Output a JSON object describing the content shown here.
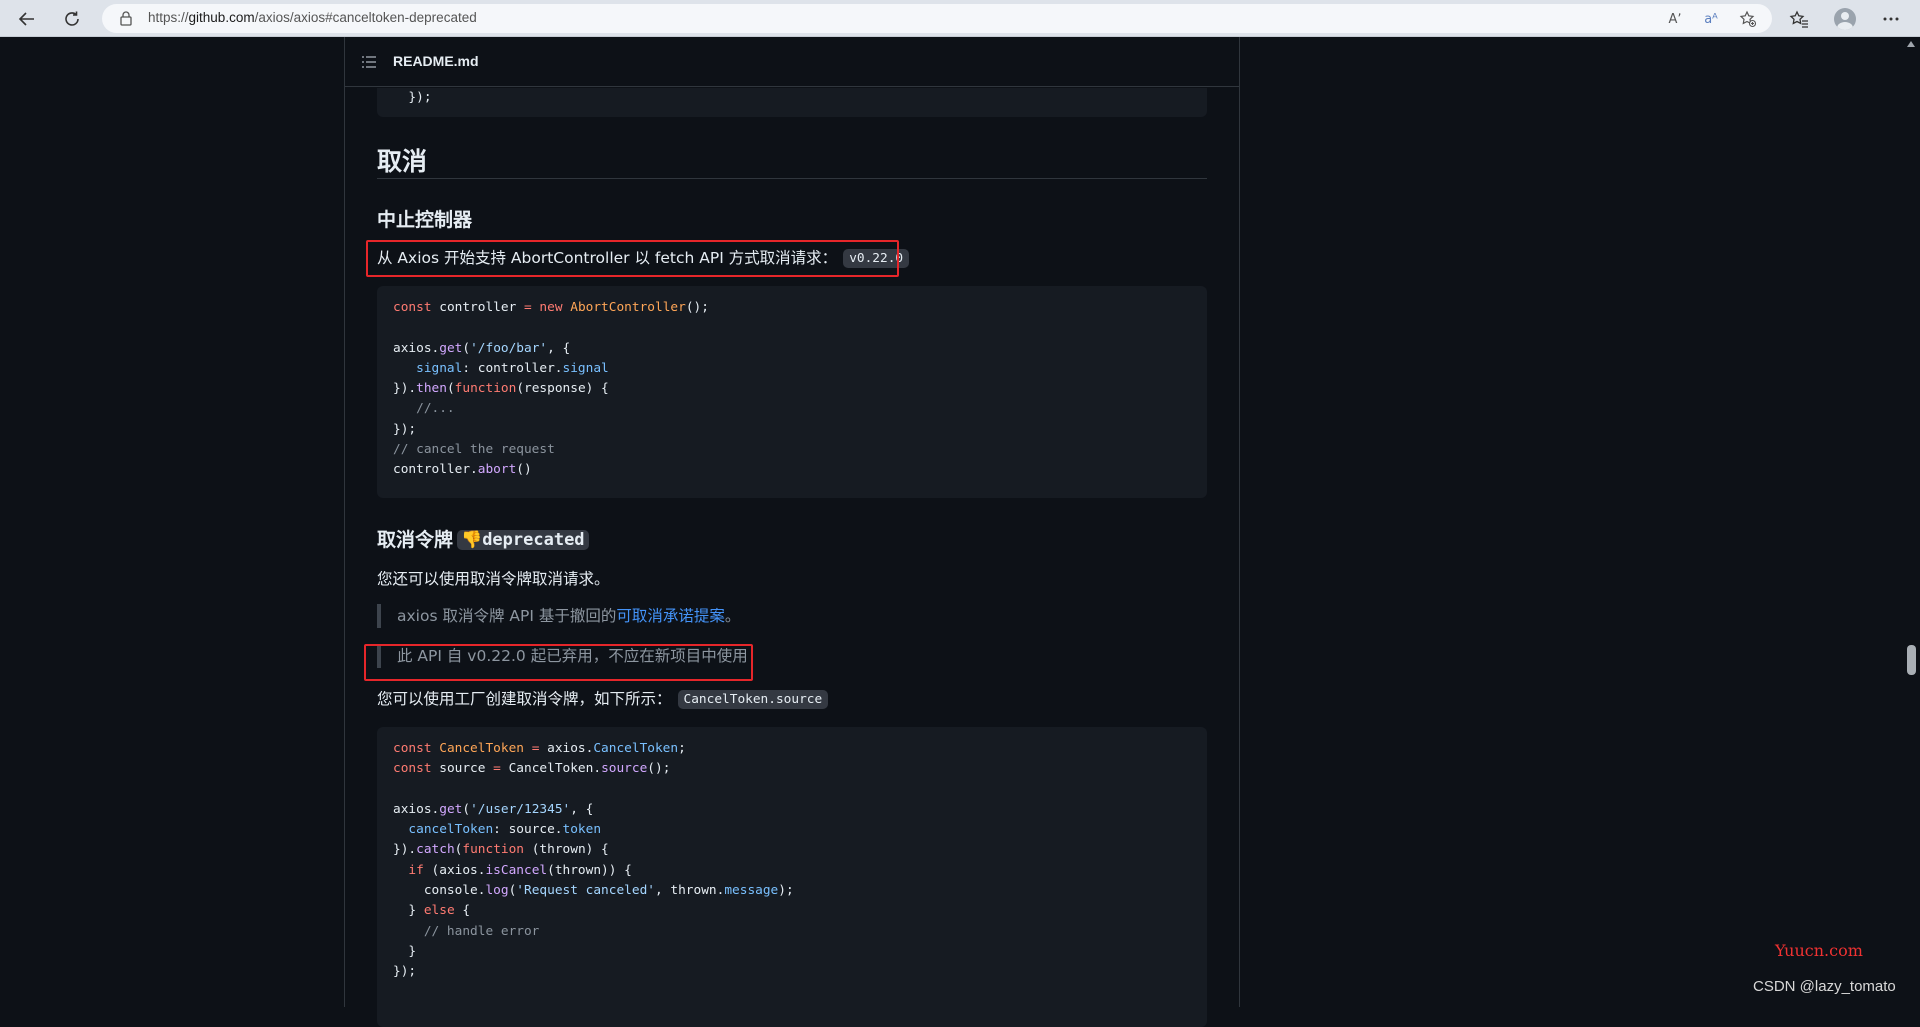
{
  "browser": {
    "url_prefix": "https://",
    "url_host": "github.com",
    "url_path": "/axios/axios#canceltoken-deprecated",
    "read_aloud_icon_label": "Aʼ",
    "translate_icon_label": "aᴬ"
  },
  "readme": {
    "file_name": "README.md"
  },
  "top_code": {
    "line": "  });"
  },
  "section_cancel": {
    "title": "取消"
  },
  "abort_controller": {
    "title": "中止控制器",
    "intro_text": "从 Axios 开始支持 AbortController 以 fetch API 方式取消请求：",
    "version_chip": "v0.22.0",
    "code": {
      "l1_a": "const",
      "l1_b": " controller ",
      "l1_c": "=",
      "l1_d": " new",
      "l1_e": " AbortController",
      "l1_f": "();",
      "l3_a": "axios.",
      "l3_b": "get",
      "l3_c": "(",
      "l3_d": "'/foo/bar'",
      "l3_e": ", {",
      "l4_a": "   signal",
      "l4_b": ": controller.",
      "l4_c": "signal",
      "l5_a": "}).",
      "l5_b": "then",
      "l5_c": "(",
      "l5_d": "function",
      "l5_e": "(response) {",
      "l6": "   //...",
      "l7": "});",
      "l8": "// cancel the request",
      "l9_a": "controller.",
      "l9_b": "abort",
      "l9_c": "()"
    }
  },
  "cancel_token": {
    "title": "取消令牌",
    "deprecated_label": "deprecated",
    "intro_text": "您还可以使用取消令牌取消请求。",
    "quote1_text": "axios 取消令牌 API 基于撤回的",
    "quote1_link": "可取消承诺提案",
    "quote1_end": "。",
    "quote2_text": "此 API 自 v0.22.0 起已弃用，不应在新项目中使用",
    "factory_text": "您可以使用工厂创建取消令牌，如下所示：",
    "factory_chip": "CancelToken.source",
    "code": {
      "l1_a": "const",
      "l1_b": " CancelToken",
      "l1_c": " =",
      "l1_d": " axios.",
      "l1_e": "CancelToken",
      "l1_f": ";",
      "l2_a": "const",
      "l2_b": " source ",
      "l2_c": "=",
      "l2_d": " CancelToken.",
      "l2_e": "source",
      "l2_f": "();",
      "l4_a": "axios.",
      "l4_b": "get",
      "l4_c": "(",
      "l4_d": "'/user/12345'",
      "l4_e": ", {",
      "l5_a": "  cancelToken",
      "l5_b": ": source.",
      "l5_c": "token",
      "l6_a": "}).",
      "l6_b": "catch",
      "l6_c": "(",
      "l6_d": "function",
      "l6_e": " (thrown) {",
      "l7_a": "  if",
      "l7_b": " (axios.",
      "l7_c": "isCancel",
      "l7_d": "(thrown)) {",
      "l8_a": "    console.",
      "l8_b": "log",
      "l8_c": "(",
      "l8_d": "'Request canceled'",
      "l8_e": ", thrown.",
      "l8_f": "message",
      "l8_g": ");",
      "l9_a": "  } ",
      "l9_b": "else",
      "l9_c": " {",
      "l10": "    // handle error",
      "l11": "  }",
      "l12": "});"
    }
  },
  "watermarks": {
    "site": "Yuucn.com",
    "author": "CSDN @lazy_tomato"
  },
  "colors": {
    "background": "#0d1117",
    "code_background": "#161b22",
    "highlight_box": "#e6262a",
    "link": "#4493f8"
  }
}
